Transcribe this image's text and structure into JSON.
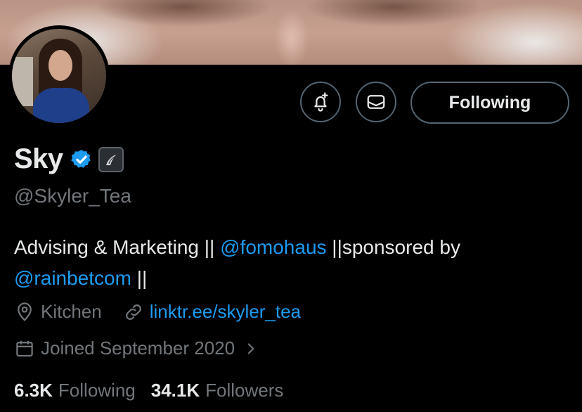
{
  "profile": {
    "name": "Sky",
    "handle": "@Skyler_Tea",
    "bio": {
      "part1": "Advising & Marketing || ",
      "mention1": "@fomohaus",
      "part2": " ||sponsored by ",
      "mention2": "@rainbetcom",
      "part3": " ||"
    },
    "location": "Kitchen",
    "website": "linktr.ee/skyler_tea",
    "joined": "Joined September 2020",
    "following_count": "6.3K",
    "following_label": "Following",
    "followers_count": "34.1K",
    "followers_label": "Followers"
  },
  "actions": {
    "follow_label": "Following"
  },
  "colors": {
    "background": "#000000",
    "text": "#e7e9ea",
    "secondary": "#71767b",
    "accent": "#1d9bf0",
    "border": "#536471"
  },
  "icons": {
    "notify": "bell-plus-icon",
    "message": "mail-icon",
    "verified": "verified-badge-icon",
    "affiliate": "affiliate-badge-icon",
    "location": "location-pin-icon",
    "link": "link-icon",
    "calendar": "calendar-icon",
    "chevron": "chevron-right-icon"
  }
}
